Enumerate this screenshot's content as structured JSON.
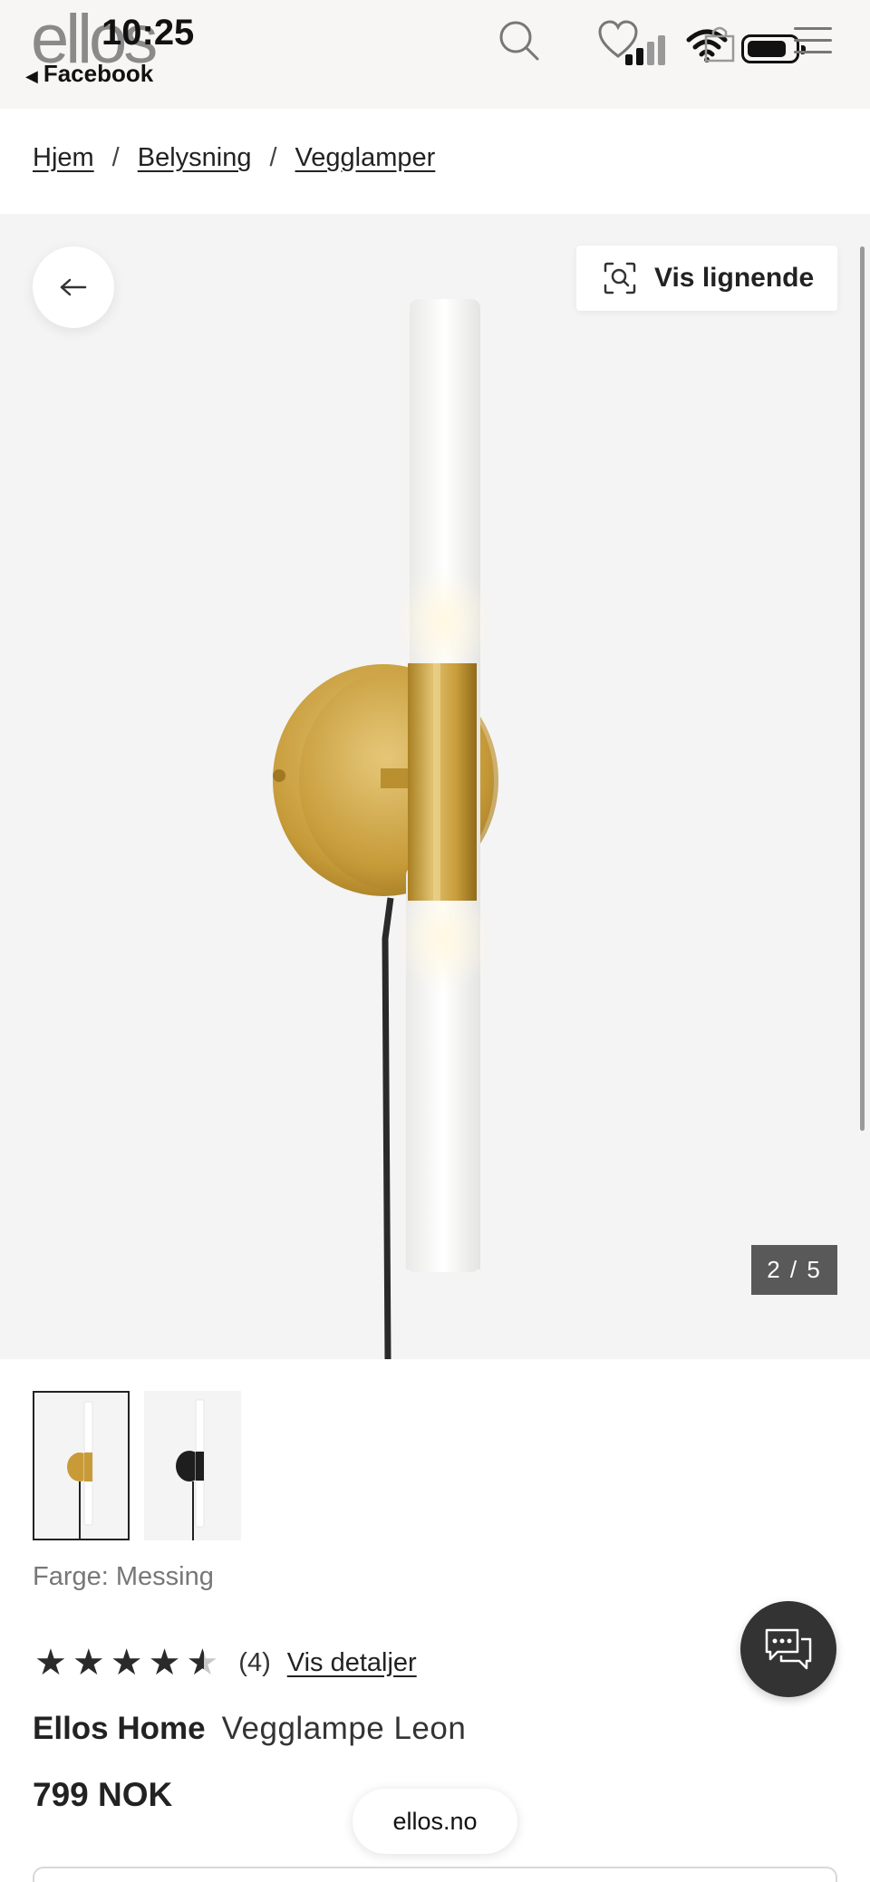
{
  "status_bar": {
    "time": "10:25",
    "back_app": "Facebook"
  },
  "header": {
    "logo": "ellos"
  },
  "breadcrumb": {
    "items": [
      "Hjem",
      "Belysning",
      "Vegglamper"
    ],
    "separator": "/"
  },
  "gallery": {
    "similar_button": "Vis lignende",
    "counter": "2 / 5",
    "current_image": 2,
    "total_images": 5
  },
  "product": {
    "color_label": "Farge: Messing",
    "rating": 4.5,
    "review_count": "(4)",
    "details_link": "Vis detaljer",
    "brand": "Ellos Home",
    "name": "Vegglampe Leon",
    "price": "799 NOK"
  },
  "browser": {
    "url": "ellos.no"
  },
  "colors": {
    "accent_dark": "#333333",
    "brass": "#c9a23c",
    "background_gallery": "#f4f4f4"
  }
}
